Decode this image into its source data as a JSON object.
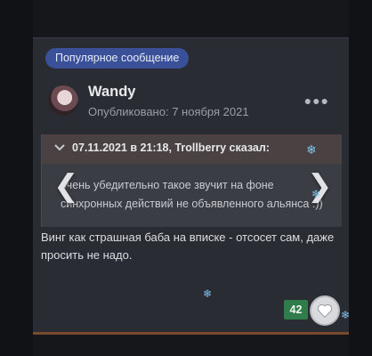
{
  "post": {
    "badge": "Популярное сообщение",
    "author": "Wandy",
    "published": "Опубликовано: 7 ноября 2021",
    "menu_icon": "ellipsis-icon",
    "quote": {
      "header": "07.11.2021 в 21:18, Trollberry сказал:",
      "body": "очень убедительно такое звучит на фоне синхронных действий не объявленного альянса :))"
    },
    "text": "Винг как страшная баба на вписке - отсосет сам, даже просить не надо.",
    "reaction_count": "42"
  },
  "colors": {
    "badge": "#3a5199",
    "reaction": "#2f7d4a",
    "card": "#292c32"
  }
}
